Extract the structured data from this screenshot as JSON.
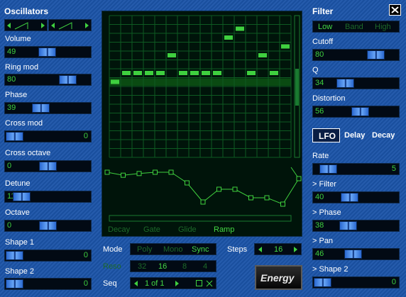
{
  "oscillators": {
    "title": "Oscillators",
    "volume": {
      "label": "Volume",
      "value": "49",
      "level": 0.49
    },
    "ringmod": {
      "label": "Ring mod",
      "value": "80",
      "level": 0.8
    },
    "phase": {
      "label": "Phase",
      "value": "39",
      "level": 0.39
    },
    "crossmod": {
      "label": "Cross mod",
      "value": "0",
      "level": 0.0
    },
    "crossoctave": {
      "label": "Cross octave",
      "value": "0",
      "level": 0.5
    },
    "detune": {
      "label": "Detune",
      "value": "11",
      "level": 0.11
    },
    "octave": {
      "label": "Octave",
      "value": "0",
      "level": 0.5
    },
    "shape1": {
      "label": "Shape 1",
      "value": "0",
      "level": 0.0
    },
    "shape2": {
      "label": "Shape 2",
      "value": "0",
      "level": 0.0
    }
  },
  "filter": {
    "title": "Filter",
    "modes": [
      "Low",
      "Band",
      "High"
    ],
    "active_mode": "Low",
    "cutoff": {
      "label": "Cutoff",
      "value": "80",
      "level": 0.8
    },
    "q": {
      "label": "Q",
      "value": "34",
      "level": 0.34
    },
    "distortion": {
      "label": "Distortion",
      "value": "56",
      "level": 0.56
    }
  },
  "tabs": {
    "lfo": "LFO",
    "delay": "Delay",
    "decay": "Decay",
    "active": "LFO"
  },
  "lfo": {
    "rate": {
      "label": "Rate",
      "value": "5",
      "level": 0.08
    },
    "to_filter": {
      "label": "> Filter",
      "value": "40",
      "level": 0.4
    },
    "to_phase": {
      "label": "> Phase",
      "value": "38",
      "level": 0.38
    },
    "to_pan": {
      "label": "> Pan",
      "value": "46",
      "level": 0.46
    },
    "to_shape2": {
      "label": "> Shape 2",
      "value": "0",
      "level": 0.0
    }
  },
  "sequencer": {
    "steps_count": 16,
    "note_rows": 16,
    "notes": [
      8,
      9,
      9,
      9,
      9,
      11,
      9,
      9,
      9,
      9,
      13,
      14,
      9,
      11,
      9,
      12
    ],
    "envelope": [
      0.85,
      0.78,
      0.82,
      0.85,
      0.85,
      0.6,
      0.15,
      0.45,
      0.45,
      0.25,
      0.25,
      0.1,
      0.7
    ],
    "modes": [
      "Decay",
      "Gate",
      "Glide",
      "Ramp"
    ],
    "active_mode": "Ramp"
  },
  "bottom": {
    "mode_label": "Mode",
    "mode_options": [
      "Poly",
      "Mono",
      "Sync"
    ],
    "mode_active": "Sync",
    "steps_label": "Steps",
    "steps_value": "16",
    "reso_label": "Reso",
    "reso_options": [
      "32",
      "16",
      "8",
      "4"
    ],
    "reso_active": "16",
    "seq_label": "Seq",
    "seq_value": "1 of 1"
  },
  "logo": "Energy",
  "colors": {
    "accent_green": "#3fd03f",
    "panel_blue": "#1b54a8",
    "display_bg": "#020a14"
  }
}
